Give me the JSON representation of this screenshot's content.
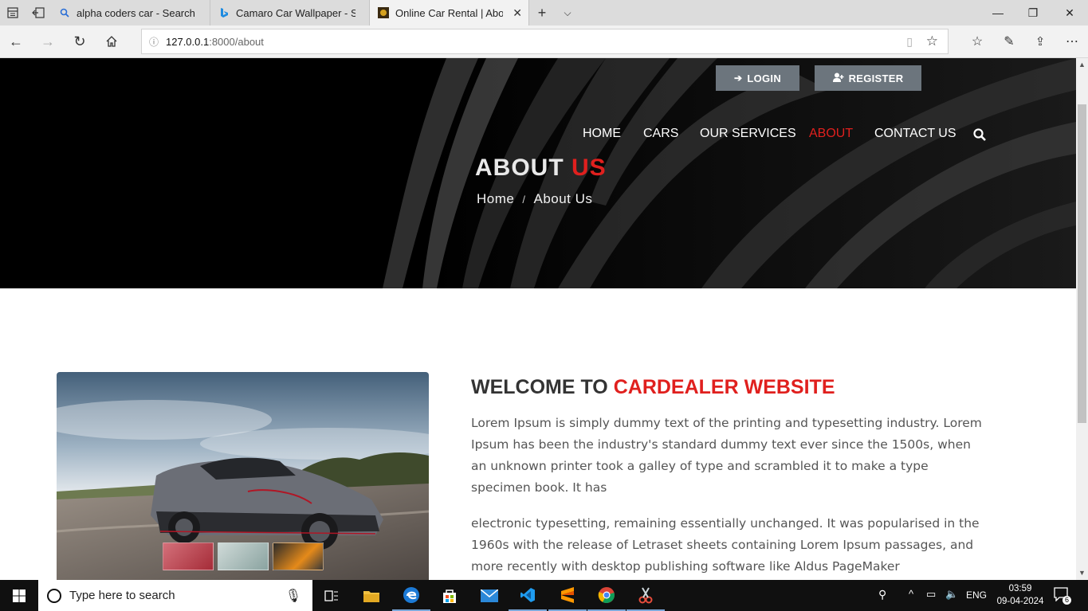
{
  "browser": {
    "tabs": [
      {
        "title": "alpha coders car - Search",
        "icon": "search-icon",
        "active": false
      },
      {
        "title": "Camaro Car Wallpaper - Sea",
        "icon": "bing-icon",
        "active": false
      },
      {
        "title": "Online Car Rental | Abou",
        "icon": "site-favicon",
        "active": true
      }
    ],
    "new_tab": "+",
    "address": {
      "host": "127.0.0.1",
      "path": ":8000/about"
    }
  },
  "page": {
    "header": {
      "login_label": "LOGIN",
      "register_label": "REGISTER",
      "nav": [
        {
          "label": "HOME",
          "current": false
        },
        {
          "label": "CARS",
          "current": false
        },
        {
          "label": "OUR SERVICES",
          "current": false
        },
        {
          "label": "ABOUT",
          "current": true
        },
        {
          "label": "CONTACT US",
          "current": false
        }
      ]
    },
    "hero": {
      "title_main": "ABOUT",
      "title_accent": "US",
      "breadcrumb_home": "Home",
      "breadcrumb_sep": "/",
      "breadcrumb_current": "About Us"
    },
    "welcome": {
      "title_main": "WELCOME TO",
      "title_accent": "CARDEALER WEBSITE",
      "paragraph1": "Lorem Ipsum is simply dummy text of the printing and typesetting industry. Lorem Ipsum has been the industry's standard dummy text ever since the 1500s, when an unknown printer took a galley of type and scrambled it to make a type specimen book. It has",
      "paragraph2": "electronic typesetting, remaining essentially unchanged. It was popularised in the 1960s with the release of Letraset sheets containing Lorem Ipsum passages, and more recently with desktop publishing software like Aldus PageMaker"
    },
    "colors": {
      "accent": "#e0201e",
      "button": "#6c757d"
    }
  },
  "taskbar": {
    "search_placeholder": "Type here to search",
    "apps": [
      "task-view-icon",
      "file-explorer-icon",
      "edge-icon",
      "store-icon",
      "mail-icon",
      "vscode-icon",
      "sublime-icon",
      "chrome-icon",
      "snipping-tool-icon"
    ],
    "language": "ENG",
    "time": "03:59",
    "date": "09-04-2024",
    "notifications": "6"
  }
}
